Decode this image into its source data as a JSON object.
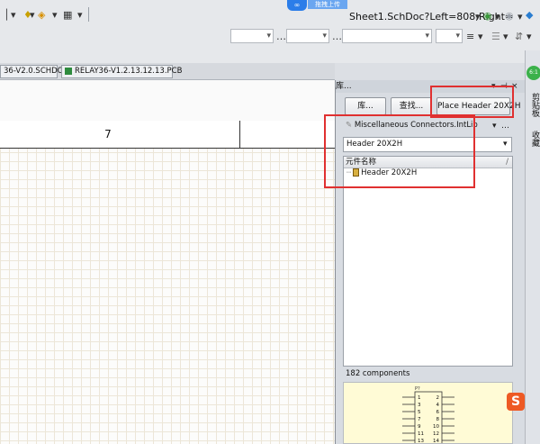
{
  "toolbar": {
    "address": "Sheet1.SchDoc?Left=808;Right=",
    "upload_label": "拖拽上传"
  },
  "tabs": [
    {
      "label": "36-V2.0.SCHDOC"
    },
    {
      "label": "RELAY36-V1.2.13.12.13.PCB"
    }
  ],
  "schematic": {
    "zone_label": "7"
  },
  "library_panel": {
    "title": "库...",
    "libraries_button": "库...",
    "search_button": "查找...",
    "place_button": "Place Header 20X2H",
    "library_name": "Miscellaneous Connectors.IntLib",
    "filter_value": "Header 20X2H",
    "list_column": "元件名称",
    "list_items": [
      {
        "name": "Header 20X2H"
      }
    ],
    "component_count": "182 components",
    "preview_pins": [
      [
        "1",
        "2"
      ],
      [
        "3",
        "4"
      ],
      [
        "5",
        "6"
      ],
      [
        "7",
        "8"
      ],
      [
        "9",
        "10"
      ],
      [
        "11",
        "12"
      ],
      [
        "13",
        "14"
      ]
    ],
    "preview_designator": "P?"
  },
  "right_sidebar": {
    "tabs": [
      {
        "label": "剪贴板"
      },
      {
        "label": "收藏"
      }
    ],
    "badge": "6:1",
    "ime_label": "S"
  }
}
